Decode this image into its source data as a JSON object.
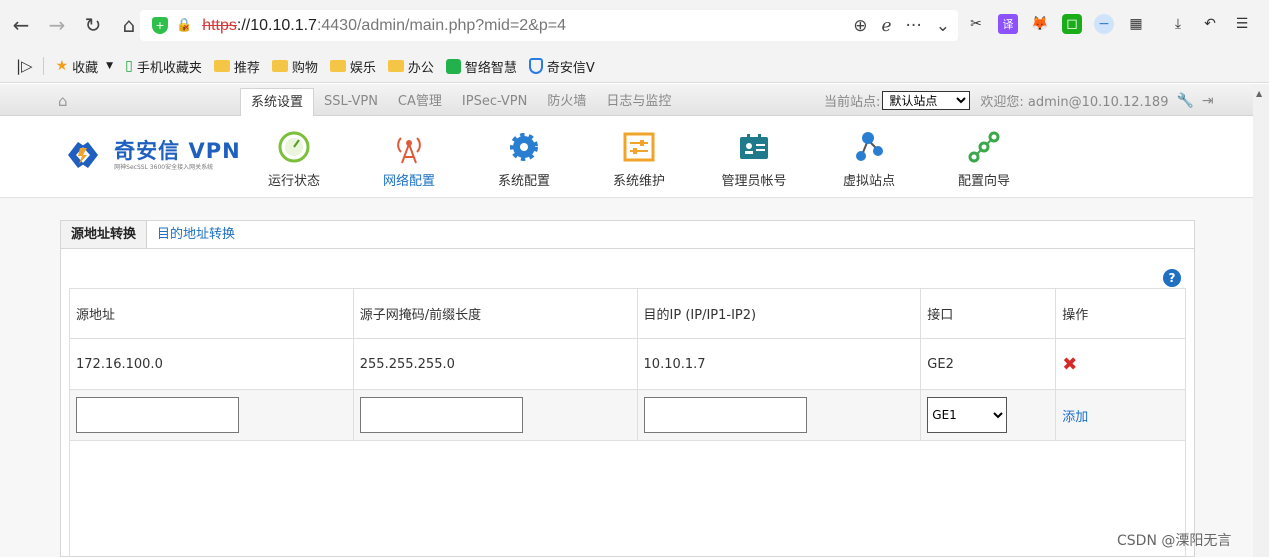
{
  "browser": {
    "url_proto": "https",
    "url_host": "://10.10.1.7",
    "url_rest": ":4430/admin/main.php?mid=2&p=4",
    "translate_label": "译"
  },
  "bookmarks": [
    {
      "label": "收藏",
      "icon": "star-icon"
    },
    {
      "label": "手机收藏夹",
      "icon": "phone-icon"
    },
    {
      "label": "推荐",
      "icon": "folder-icon"
    },
    {
      "label": "购物",
      "icon": "folder-icon"
    },
    {
      "label": "娱乐",
      "icon": "folder-icon"
    },
    {
      "label": "办公",
      "icon": "folder-icon"
    },
    {
      "label": "智络智慧",
      "icon": "app-icon"
    },
    {
      "label": "奇安信V",
      "icon": "shield-icon"
    }
  ],
  "header": {
    "tabs": [
      "系统设置",
      "SSL-VPN",
      "CA管理",
      "IPSec-VPN",
      "防火墙",
      "日志与监控"
    ],
    "active_tab": "系统设置",
    "site_label": "当前站点:",
    "site_value": "默认站点",
    "welcome": "欢迎您: admin@10.10.12.189"
  },
  "logo": {
    "main": "奇安信 VPN",
    "sub": "网神SecSSL 3600安全接入网关系统"
  },
  "nav": {
    "items": [
      {
        "label": "运行状态",
        "icon": "gauge-icon"
      },
      {
        "label": "网络配置",
        "icon": "antenna-icon"
      },
      {
        "label": "系统配置",
        "icon": "gear-icon"
      },
      {
        "label": "系统维护",
        "icon": "maintenance-icon"
      },
      {
        "label": "管理员帐号",
        "icon": "admin-card-icon"
      },
      {
        "label": "虚拟站点",
        "icon": "network-nodes-icon"
      },
      {
        "label": "配置向导",
        "icon": "wizard-icon"
      }
    ],
    "active": "网络配置"
  },
  "subtabs": {
    "active": "源地址转换",
    "inactive": "目的地址转换"
  },
  "table": {
    "headers": [
      "源地址",
      "源子网掩码/前缀长度",
      "目的IP (IP/IP1-IP2)",
      "接口",
      "操作"
    ],
    "rows": [
      {
        "src": "172.16.100.0",
        "mask": "255.255.255.0",
        "dst": "10.10.1.7",
        "iface": "GE2"
      }
    ],
    "new_row": {
      "iface_selected": "GE1",
      "add_label": "添加"
    }
  },
  "watermark": "CSDN @溧阳无言"
}
